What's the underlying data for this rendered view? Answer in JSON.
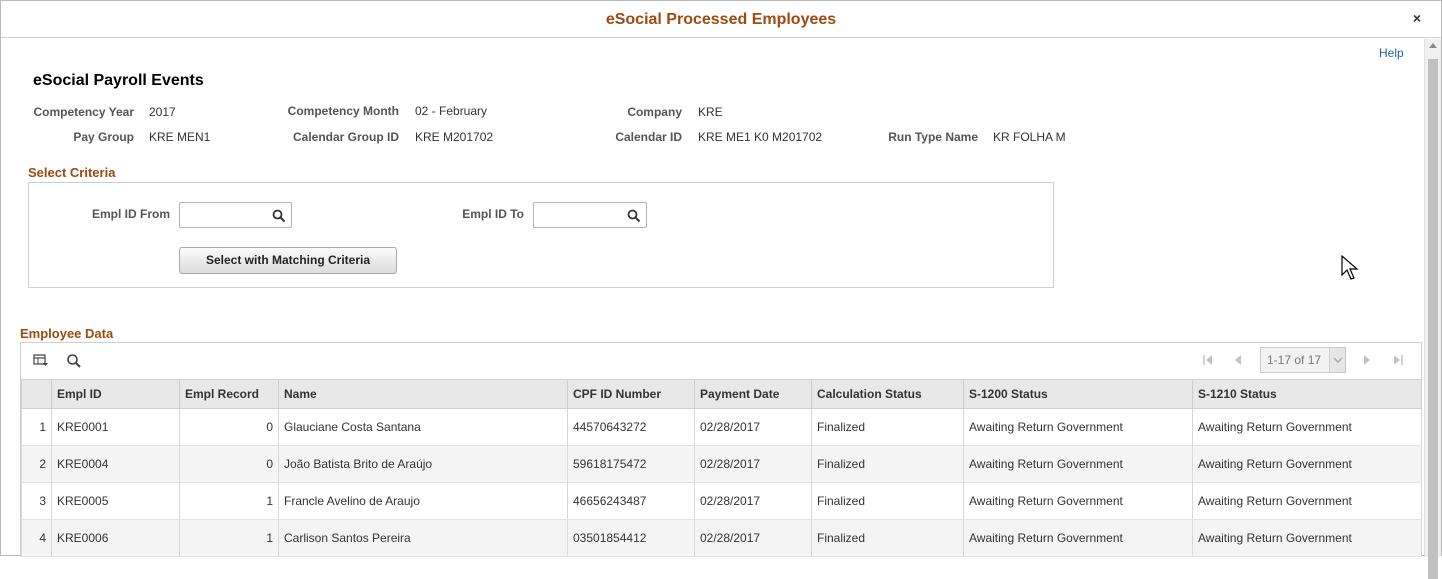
{
  "modal": {
    "title": "eSocial Processed Employees",
    "close": "×"
  },
  "help": "Help",
  "page_title": "eSocial Payroll Events",
  "header": {
    "competency_year_label": "Competency Year",
    "competency_year": "2017",
    "competency_month_label": "Competency Month",
    "competency_month": "02 - February",
    "company_label": "Company",
    "company": "KRE",
    "pay_group_label": "Pay Group",
    "pay_group": "KRE MEN1",
    "calendar_group_label": "Calendar Group ID",
    "calendar_group": "KRE M201702",
    "calendar_id_label": "Calendar ID",
    "calendar_id": "KRE ME1 K0 M201702",
    "run_type_label": "Run Type Name",
    "run_type": "KR FOLHA M"
  },
  "criteria": {
    "section_title": "Select Criteria",
    "from_label": "Empl ID From",
    "from_value": "",
    "to_label": "Empl ID To",
    "to_value": "",
    "button": "Select with Matching Criteria"
  },
  "grid": {
    "section_title": "Employee Data",
    "pager_text": "1-17 of 17",
    "columns": [
      "",
      "Empl ID",
      "Empl Record",
      "Name",
      "CPF ID Number",
      "Payment Date",
      "Calculation Status",
      "S-1200 Status",
      "S-1210 Status"
    ],
    "rows": [
      [
        "1",
        "KRE0001",
        "0",
        "Glauciane Costa Santana",
        "44570643272",
        "02/28/2017",
        "Finalized",
        "Awaiting Return Government",
        "Awaiting Return Government"
      ],
      [
        "2",
        "KRE0004",
        "0",
        "João Batista Brito de Araújo",
        "59618175472",
        "02/28/2017",
        "Finalized",
        "Awaiting Return Government",
        "Awaiting Return Government"
      ],
      [
        "3",
        "KRE0005",
        "1",
        "Francle Avelino de Araujo",
        "46656243487",
        "02/28/2017",
        "Finalized",
        "Awaiting Return Government",
        "Awaiting Return Government"
      ],
      [
        "4",
        "KRE0006",
        "1",
        "Carlison Santos Pereira",
        "03501854412",
        "02/28/2017",
        "Finalized",
        "Awaiting Return Government",
        "Awaiting Return Government"
      ]
    ]
  }
}
